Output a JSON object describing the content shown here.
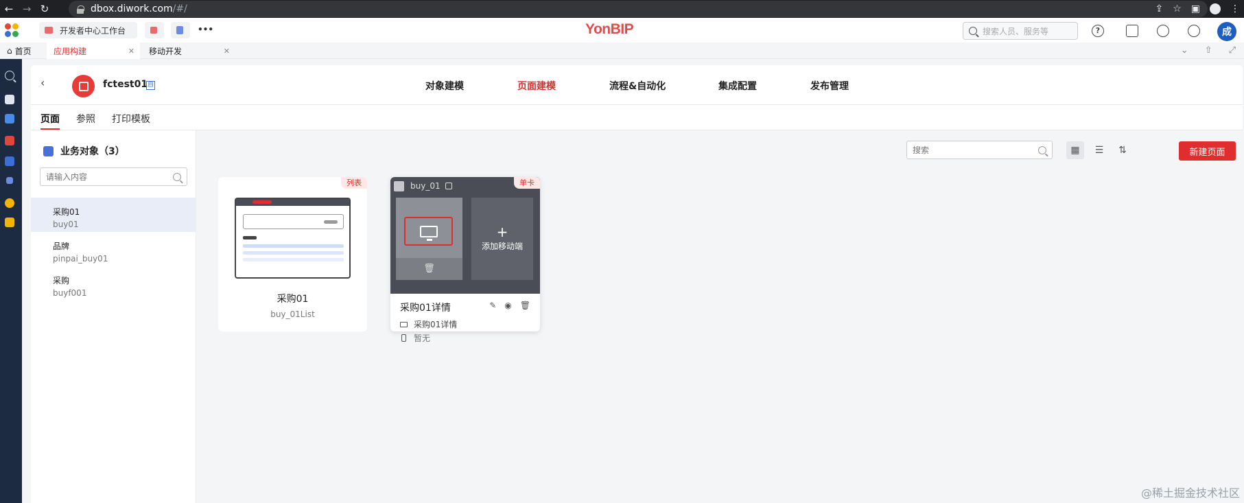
{
  "browser": {
    "url_host": "dbox.diwork.com",
    "url_path": "/#/"
  },
  "header": {
    "brand": "YonBIP",
    "workspace_tab": "开发者中心工作台",
    "more": "•••",
    "search_placeholder": "搜索人员、服务等",
    "user_initial": "成",
    "help_icon_text": "?"
  },
  "tabs": [
    {
      "label": "首页",
      "icon": "home-icon"
    },
    {
      "label": "应用构建",
      "active": true
    },
    {
      "label": "移动开发"
    }
  ],
  "app": {
    "name": "fctest01",
    "badge": "自",
    "nav": [
      {
        "label": "对象建模"
      },
      {
        "label": "页面建模",
        "active": true
      },
      {
        "label": "流程&自动化"
      },
      {
        "label": "集成配置"
      },
      {
        "label": "发布管理"
      }
    ],
    "subtabs": [
      {
        "label": "页面",
        "active": true
      },
      {
        "label": "参照"
      },
      {
        "label": "打印模板"
      }
    ]
  },
  "sidebar": {
    "title": "业务对象（3）",
    "search_placeholder": "请输入内容",
    "items": [
      {
        "name": "采购01",
        "code": "buy01",
        "selected": true
      },
      {
        "name": "品牌",
        "code": "pinpai_buy01"
      },
      {
        "name": "采购",
        "code": "buyf001"
      }
    ]
  },
  "toolbar": {
    "search_placeholder": "搜索",
    "new_button": "新建页面"
  },
  "cards": [
    {
      "tag": "列表",
      "title": "采购01",
      "code": "buy_01List"
    },
    {
      "tag": "单卡",
      "code": "buy_01",
      "title": "采购01详情",
      "add_mobile": "添加移动端",
      "pc_page": "采购01详情",
      "mobile_page": "暂无"
    }
  ],
  "watermark": "@稀土掘金技术社区",
  "colors": {
    "accent": "#e02e2e",
    "rail": "#1c2b41",
    "brand_blue": "#1f5ebf"
  }
}
